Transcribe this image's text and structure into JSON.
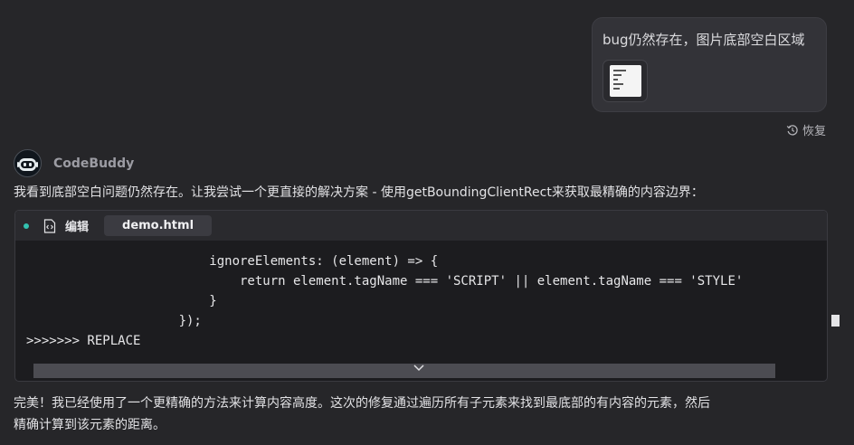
{
  "user_message": {
    "text": "bug仍然存在，图片底部空白区域",
    "attachment_icon": "image-thumbnail"
  },
  "restore": {
    "icon": "history-icon",
    "label": "恢复"
  },
  "assistant": {
    "name": "CodeBuddy",
    "avatar_icon": "robot-icon",
    "intro": "我看到底部空白问题仍然存在。让我尝试一个更直接的解决方案 - 使用getBoundingClientRect来获取最精确的内容边界：",
    "code_block": {
      "status_color": "#33c2b0",
      "action_icon": "code-file-icon",
      "action_label": "编辑",
      "file_name": "demo.html",
      "lines": [
        "                        ignoreElements: (element) => {",
        "                            return element.tagName === 'SCRIPT' || element.tagName === 'STYLE'",
        "                        }",
        "                    });",
        ">>>>>>> REPLACE"
      ],
      "expand_icon": "chevron-down-icon"
    },
    "summary_lines": [
      "完美！我已经使用了一个更精确的方法来计算内容高度。这次的修复通过遍历所有子元素来找到最底部的有内容的元素，然后",
      "精确计算到该元素的距离。"
    ]
  }
}
